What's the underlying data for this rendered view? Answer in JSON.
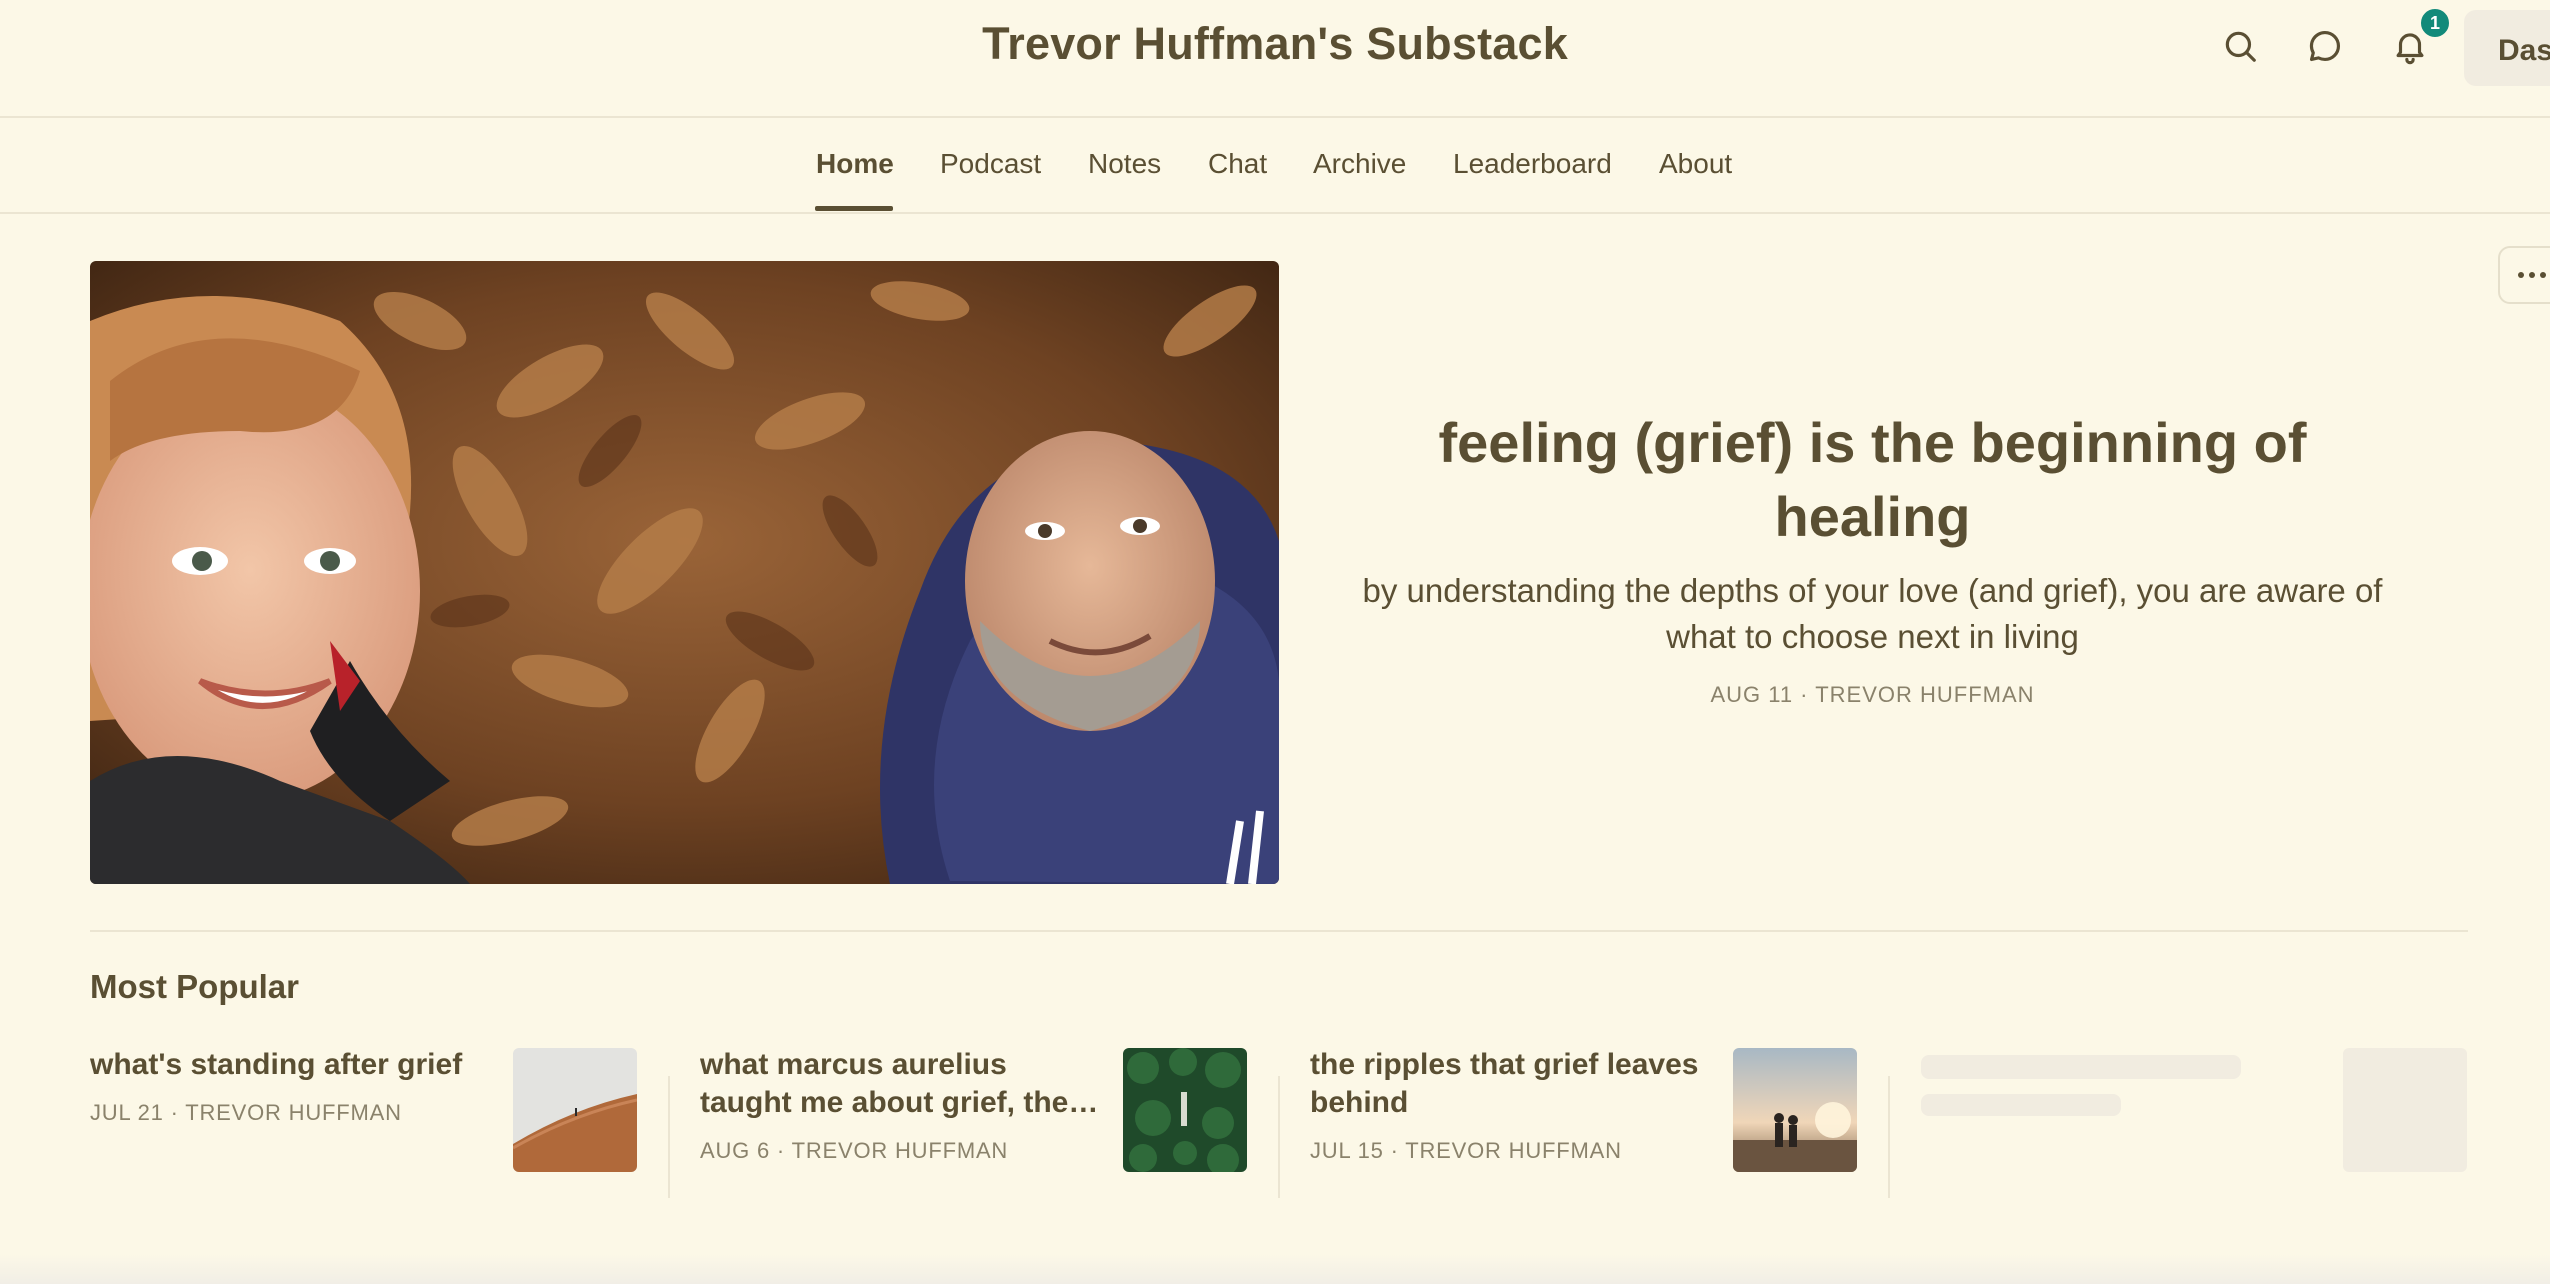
{
  "header": {
    "site_title": "Trevor Huffman's Substack",
    "icons": [
      "search-icon",
      "chat-bubble-icon",
      "bell-icon"
    ],
    "notification_count": "1",
    "dashboard_label": "Das"
  },
  "nav": {
    "items": [
      "Home",
      "Podcast",
      "Notes",
      "Chat",
      "Archive",
      "Leaderboard",
      "About"
    ],
    "active": "Home"
  },
  "featured": {
    "title": "feeling (grief) is the beginning of healing",
    "subtitle": "by understanding the depths of your love (and grief), you are aware of what to choose next in living",
    "meta": "AUG 11 · TREVOR HUFFMAN"
  },
  "most_popular": {
    "heading": "Most Popular",
    "posts": [
      {
        "title": "what's standing after grief",
        "meta": "JUL 21 · TREVOR HUFFMAN"
      },
      {
        "title": "what marcus aurelius taught me about grief, the…",
        "meta": "AUG 6 · TREVOR HUFFMAN"
      },
      {
        "title": "the ripples that grief leaves behind",
        "meta": "JUL 15 · TREVOR HUFFMAN"
      }
    ]
  },
  "colors": {
    "background": "#fcf8e7",
    "text": "#5a4f33",
    "muted": "#8a826b",
    "badge": "#128a7a"
  }
}
